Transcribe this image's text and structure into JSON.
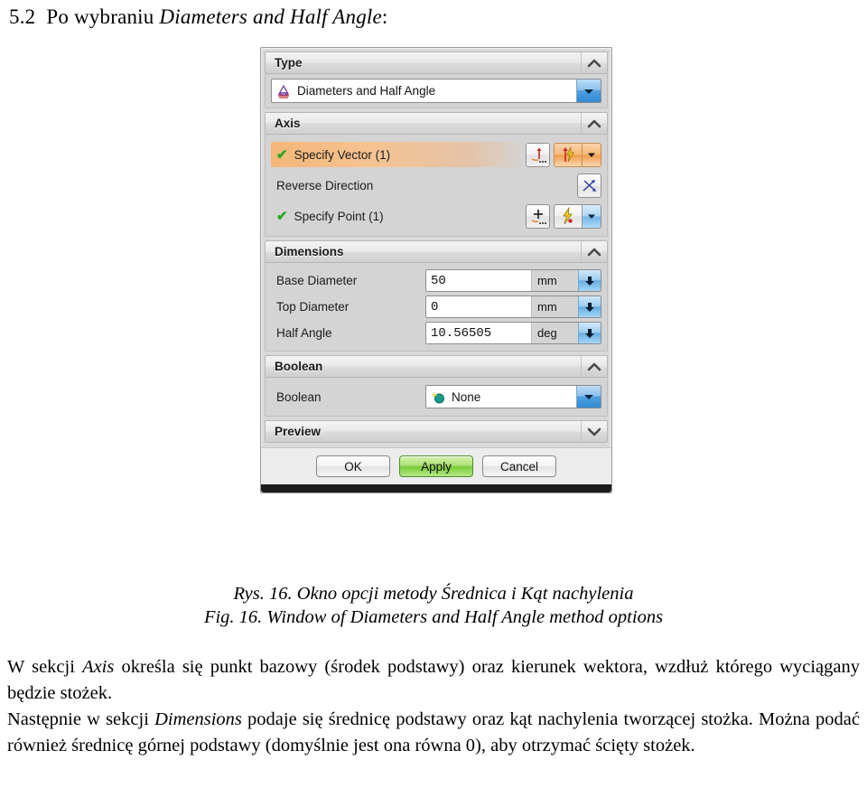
{
  "heading": {
    "number": "5.2",
    "text_before": "Po wybraniu ",
    "emphasis": "Diameters and Half Angle",
    "text_after": ":"
  },
  "dialog": {
    "sections": {
      "type": {
        "title": "Type",
        "collapse_state": "expanded",
        "combo": {
          "icon": "cone-frustum-icon",
          "value": "Diameters and Half Angle"
        }
      },
      "axis": {
        "title": "Axis",
        "collapse_state": "expanded",
        "rows": [
          {
            "label": "Specify Vector (1)",
            "selected": true,
            "status_icon": "green-check-icon",
            "buttons": [
              "vector-dialog-icon",
              "inferred-vector-icon",
              "dropdown-arrow-icon"
            ]
          },
          {
            "label": "Reverse Direction",
            "selected": false,
            "status_icon": "",
            "buttons": [
              "reverse-direction-icon"
            ]
          },
          {
            "label": "Specify Point (1)",
            "selected": false,
            "status_icon": "green-check-icon",
            "buttons": [
              "point-dialog-icon",
              "inferred-point-icon",
              "dropdown-arrow-icon"
            ]
          }
        ]
      },
      "dimensions": {
        "title": "Dimensions",
        "collapse_state": "expanded",
        "fields": [
          {
            "label": "Base Diameter",
            "value": "50",
            "unit": "mm"
          },
          {
            "label": "Top Diameter",
            "value": "0",
            "unit": "mm"
          },
          {
            "label": "Half Angle",
            "value": "10.56505",
            "unit": "deg"
          }
        ]
      },
      "boolean": {
        "title": "Boolean",
        "collapse_state": "expanded",
        "row_label": "Boolean",
        "combo": {
          "icon": "boolean-none-icon",
          "value": "None"
        }
      },
      "preview": {
        "title": "Preview",
        "collapse_state": "collapsed"
      }
    },
    "buttons": {
      "ok": "OK",
      "apply": "Apply",
      "cancel": "Cancel"
    }
  },
  "caption": {
    "line_pl": "Rys. 16. Okno opcji metody Średnica i Kąt nachylenia",
    "line_en": "Fig. 16. Window of Diameters and Half Angle method options"
  },
  "body": {
    "p1_a": "W sekcji ",
    "p1_em": "Axis",
    "p1_b": " określa się punkt bazowy (środek podstawy) oraz kierunek wektora, wzdłuż którego wyciągany będzie stożek.",
    "p2_a": "Następnie w sekcji ",
    "p2_em": "Dimensions",
    "p2_b": " podaje się średnicę podstawy oraz kąt nachylenia tworzącej stożka. Można podać również średnicę górnej podstawy (domyślnie jest ona równa 0), aby otrzymać ścięty stożek."
  },
  "colors": {
    "selection_orange": "#f4b779",
    "apply_green": "#79cb35",
    "check_green": "#22aa22",
    "dropdown_blue": "#4fa0df"
  }
}
